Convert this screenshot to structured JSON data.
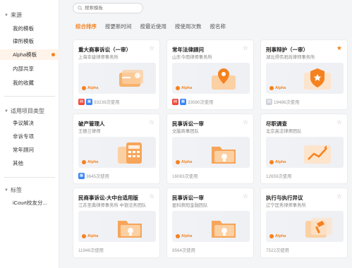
{
  "sidebar": {
    "sections": [
      {
        "title": "来源",
        "items": [
          {
            "label": "我的模板",
            "active": false
          },
          {
            "label": "律所模板",
            "active": false
          },
          {
            "label": "Alpha模板",
            "active": true
          },
          {
            "label": "内部共享",
            "active": false
          },
          {
            "label": "我的收藏",
            "active": false
          }
        ]
      },
      {
        "title": "适用项目类型",
        "items": [
          {
            "label": "争议解决"
          },
          {
            "label": "非诉专项"
          },
          {
            "label": "常年顾问"
          },
          {
            "label": "其他"
          }
        ]
      },
      {
        "title": "标签",
        "items": [
          {
            "label": "iCourt校友分..."
          }
        ]
      }
    ]
  },
  "search": {
    "placeholder": "搜索模板"
  },
  "sort_tabs": [
    "综合排序",
    "按更新时间",
    "按最近使用",
    "按使用次数",
    "按名称"
  ],
  "cards": [
    {
      "title": "重大商事诉讼（一审）",
      "subtitle": "上海幸骏律师事务所",
      "usage": "93239次使用",
      "tags": [
        "red",
        "blue"
      ],
      "starred": false,
      "art": "card"
    },
    {
      "title": "常年法律顾问",
      "subtitle": "山东今雨律师事务所",
      "usage": "33580次使用",
      "tags": [
        "red",
        "blue"
      ],
      "starred": false,
      "art": "pin"
    },
    {
      "title": "刑事辩护（一审）",
      "subtitle": "湖北得伟君尚律师事务所",
      "usage": "19486次使用",
      "tags": [
        "gray"
      ],
      "starred": true,
      "art": "shield"
    },
    {
      "title": "破产管理人",
      "subtitle": "王德兰律师",
      "usage": "3645次使用",
      "tags": [
        "blue"
      ],
      "starred": false,
      "art": "calc"
    },
    {
      "title": "民事诉讼一审",
      "subtitle": "文脑商事团队",
      "usage": "16083次使用",
      "tags": [],
      "starred": false,
      "art": "folder"
    },
    {
      "title": "尽职调查",
      "subtitle": "北京高法律师团队",
      "usage": "12659次使用",
      "tags": [],
      "starred": false,
      "art": "chart"
    },
    {
      "title": "民商事诉讼-大中台适用版",
      "subtitle": "江苏圣典律师事务所 中银法务团队",
      "usage": "11946次使用",
      "tags": [],
      "starred": false,
      "art": "folder"
    },
    {
      "title": "民事诉讼一审",
      "subtitle": "盈科赍阳金融团队",
      "usage": "9564次使用",
      "tags": [],
      "starred": false,
      "art": "folder"
    },
    {
      "title": "执行与执行异议",
      "subtitle": "辽宁匡秀律师事务所",
      "usage": "7522次使用",
      "tags": [],
      "starred": false,
      "art": "gavel"
    }
  ],
  "thumb_brand": "Alpha",
  "colors": {
    "accent": "#f5821f",
    "tag_red": "#f04a3b",
    "tag_blue": "#3a86f5"
  }
}
